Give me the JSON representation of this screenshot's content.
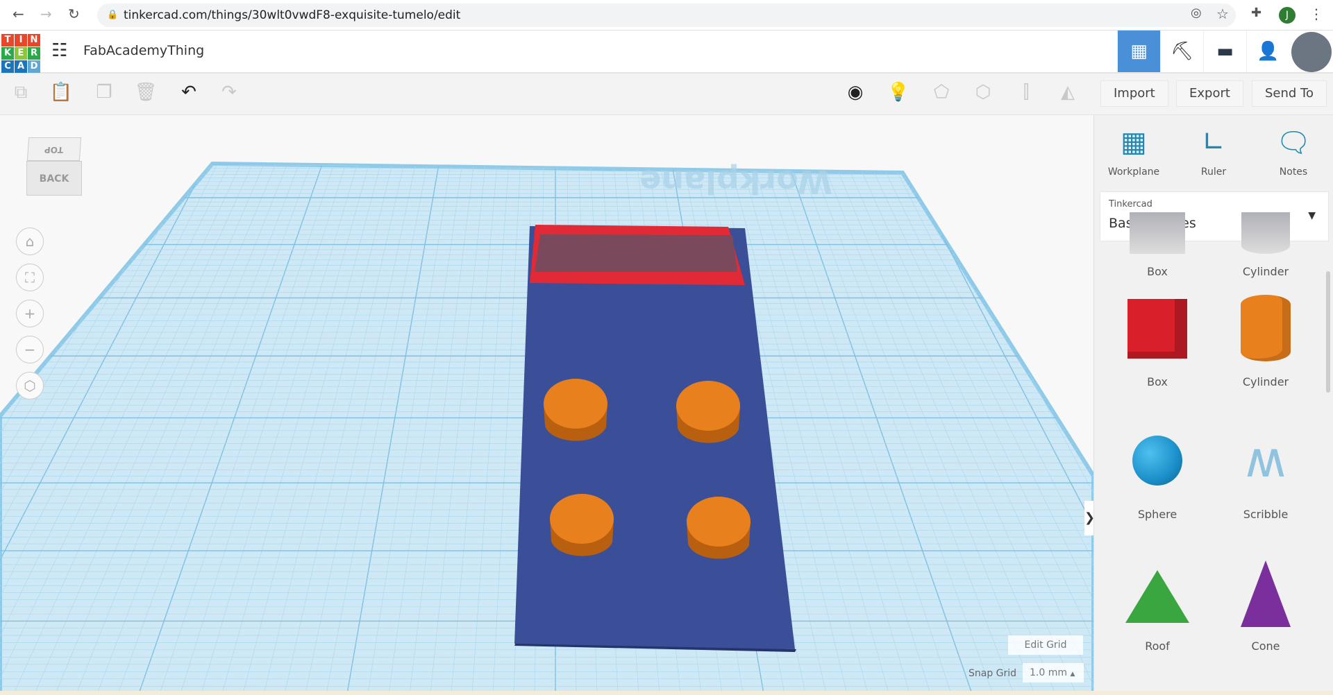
{
  "browser": {
    "url": "tinkercad.com/things/30wlt0vwdF8-exquisite-tumelo/edit",
    "avatar_letter": "J"
  },
  "app": {
    "logo_letters": [
      "T",
      "I",
      "N",
      "K",
      "E",
      "R",
      "C",
      "A",
      "D"
    ],
    "logo_colors": [
      "#e8472b",
      "#e8472b",
      "#e8472b",
      "#2aa84a",
      "#8cc63f",
      "#2aa84a",
      "#1b75bc",
      "#1b75bc",
      "#5fa8d3"
    ],
    "project_title": "FabAcademyThing",
    "accent": "#4a90d9"
  },
  "toolbar": {
    "import": "Import",
    "export": "Export",
    "send_to": "Send To"
  },
  "viewport": {
    "view_cube_top": "TOP",
    "view_cube_front": "BACK",
    "workplane_label": "Workplane",
    "edit_grid": "Edit Grid",
    "snap_grid_label": "Snap Grid",
    "snap_grid_value": "1.0 mm"
  },
  "panel": {
    "workplane": "Workplane",
    "ruler": "Ruler",
    "notes": "Notes",
    "library_source": "Tinkercad",
    "library_name": "Basic Shapes",
    "shapes": [
      {
        "label": "Box",
        "color": "#b0b0b8"
      },
      {
        "label": "Cylinder",
        "color": "#b0b0b8"
      },
      {
        "label": "Box",
        "color": "#d9202a"
      },
      {
        "label": "Cylinder",
        "color": "#e8801e"
      },
      {
        "label": "Sphere",
        "color": "#1b8fc9"
      },
      {
        "label": "Scribble",
        "color": "#8fc3e0"
      },
      {
        "label": "Roof",
        "color": "#3aa640"
      },
      {
        "label": "Cone",
        "color": "#7b2f9c"
      }
    ]
  }
}
